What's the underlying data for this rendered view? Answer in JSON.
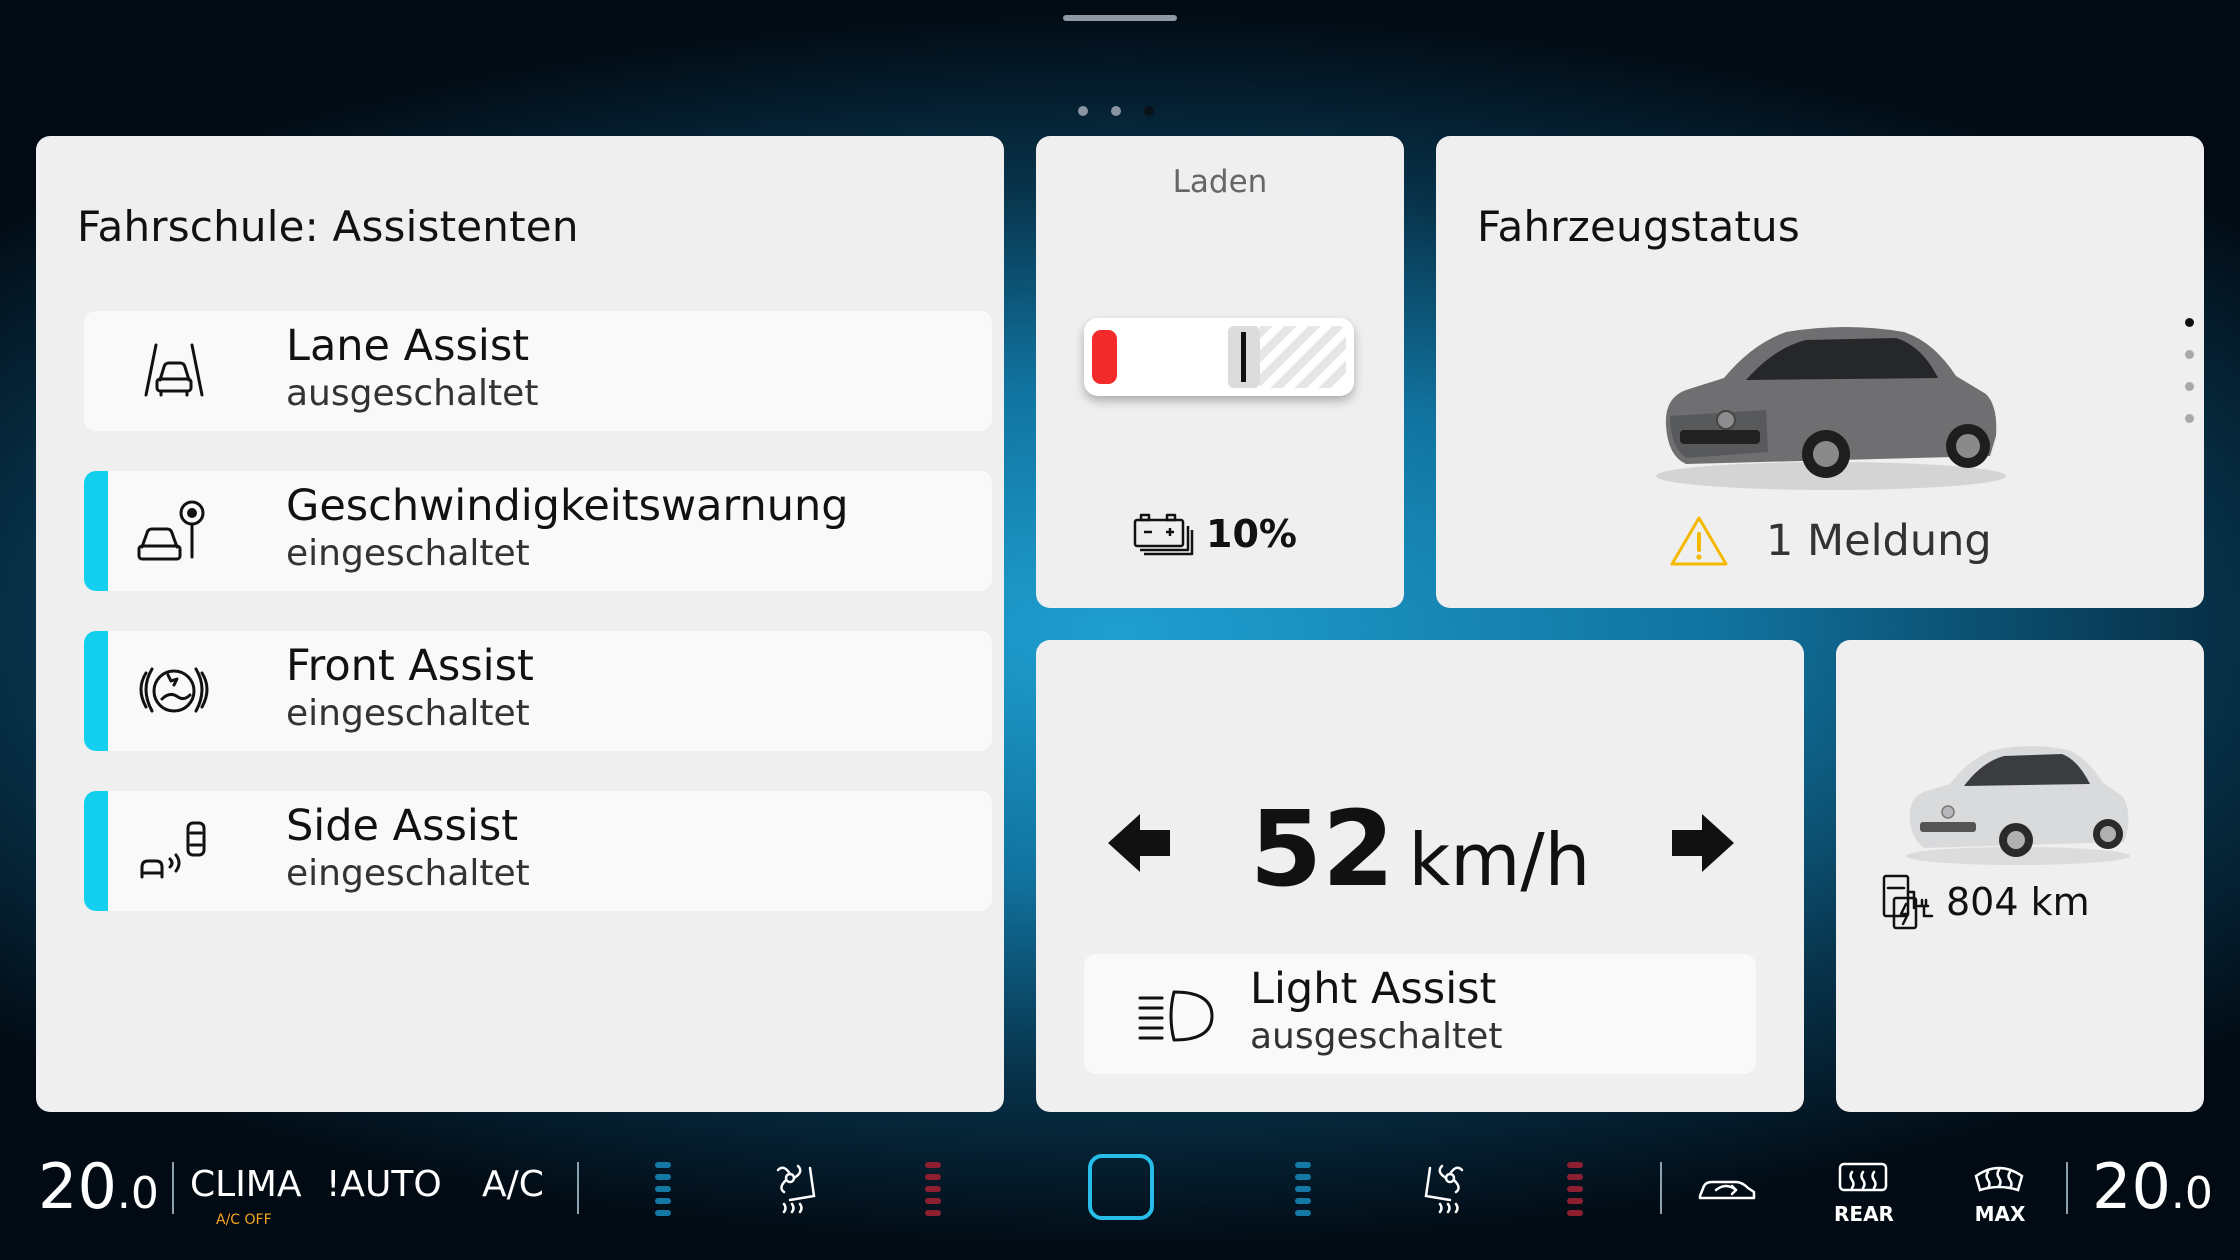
{
  "assist_card": {
    "title": "Fahrschule: Assistenten",
    "items": [
      {
        "name": "Lane Assist",
        "state": "ausgeschaltet",
        "icon": "lane-assist-icon",
        "active": false
      },
      {
        "name": "Geschwindigkeitswarnung",
        "state": "eingeschaltet",
        "icon": "speed-warning-icon",
        "active": true
      },
      {
        "name": "Front Assist",
        "state": "eingeschaltet",
        "icon": "front-assist-icon",
        "active": true
      },
      {
        "name": "Side Assist",
        "state": "eingeschaltet",
        "icon": "side-assist-icon",
        "active": true
      }
    ]
  },
  "charge_card": {
    "label": "Laden",
    "battery_level_percent": 10,
    "value": "10%",
    "icon": "battery-icon"
  },
  "status_card": {
    "title": "Fahrzeugstatus",
    "messages": "1 Meldung",
    "icon": "warning-icon",
    "page_count": 4,
    "current_page": 1
  },
  "speed_card": {
    "speed": "52",
    "unit": "km/h",
    "light_assist": {
      "name": "Light Assist",
      "state": "ausgeschaltet",
      "icon": "headlight-icon"
    }
  },
  "range_card": {
    "range": "804 km",
    "icon": "fuel-electric-icon"
  },
  "climate": {
    "left_temp": "20",
    "left_temp_decimal": ".0",
    "clima": "CLIMA",
    "ac_off": "A/C OFF",
    "auto": "!AUTO",
    "ac": "A/C",
    "rear": "REAR",
    "max": "MAX",
    "right_temp": "20",
    "right_temp_decimal": ".0"
  },
  "colors": {
    "accent": "#13d0ee",
    "battery_low": "#f22a2a",
    "warning": "#f5b800",
    "ac_off": "#f6a41c"
  }
}
